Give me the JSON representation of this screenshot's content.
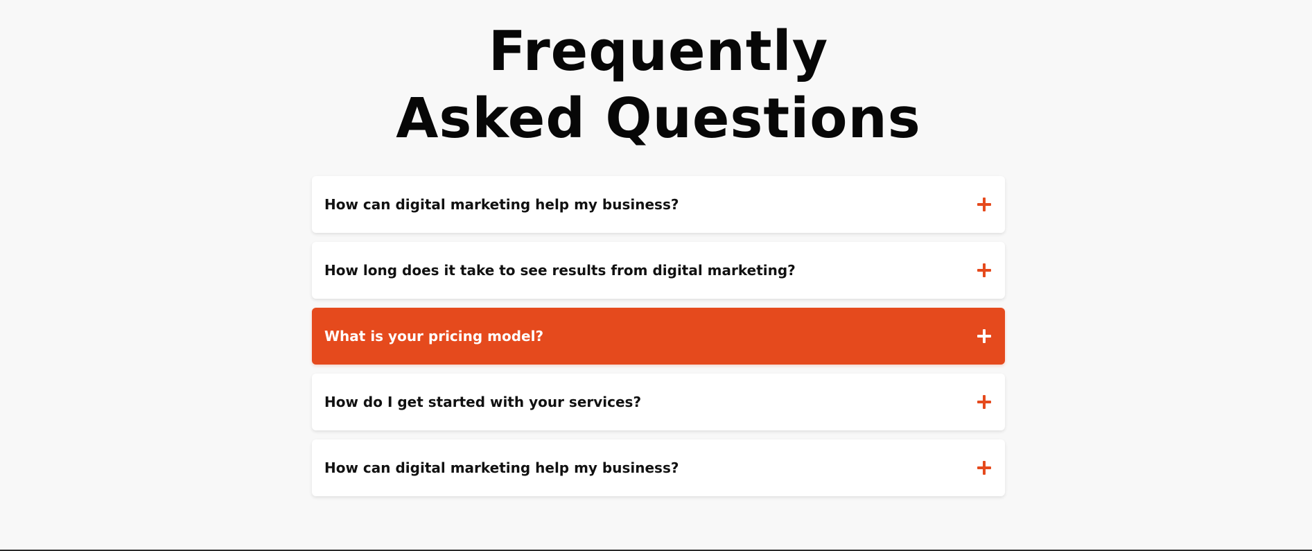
{
  "heading": {
    "line1": "Frequently",
    "line2": "Asked Questions"
  },
  "faq": {
    "items": [
      {
        "question": "How can digital marketing help my business?",
        "icon": "plus-icon",
        "active": false
      },
      {
        "question": "How long does it take to see results from digital marketing?",
        "icon": "plus-icon",
        "active": false
      },
      {
        "question": "What is your pricing model?",
        "icon": "plus-icon",
        "active": true
      },
      {
        "question": "How do I get started with your services?",
        "icon": "plus-icon",
        "active": false
      },
      {
        "question": "How can digital marketing help my business?",
        "icon": "plus-icon",
        "active": false
      }
    ]
  },
  "colors": {
    "accent": "#e54a1d",
    "background": "#f8f8f8",
    "card": "#ffffff",
    "text": "#111111"
  }
}
